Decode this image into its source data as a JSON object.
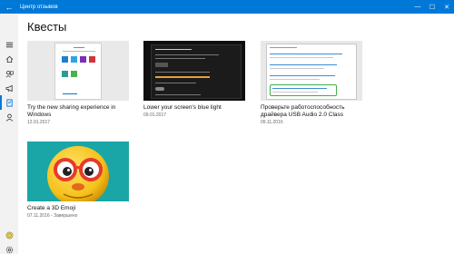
{
  "window": {
    "title": "Центр отзывов",
    "back_glyph": "←",
    "minimize_glyph": "—",
    "maximize_glyph": "☐",
    "close_glyph": "✕"
  },
  "sidebar": {
    "items": [
      {
        "icon": "hamburger-menu-icon"
      },
      {
        "icon": "home-icon"
      },
      {
        "icon": "feedback-icon"
      },
      {
        "icon": "announcements-icon"
      },
      {
        "icon": "quests-icon",
        "active": true
      },
      {
        "icon": "profile-icon"
      },
      {
        "icon": "achievement-icon"
      },
      {
        "icon": "settings-icon"
      }
    ]
  },
  "page": {
    "title": "Квесты"
  },
  "quests": [
    {
      "title": "Try the new sharing experience in Windows",
      "meta": "12.01.2017",
      "thumb": "sharing-screenshot"
    },
    {
      "title": "Lower your screen's blue light",
      "meta": "09.01.2017",
      "thumb": "night-light-settings-screenshot"
    },
    {
      "title": "Проверьте работоспособность драйвера USB Audio 2.0 Class",
      "meta": "09.11.2016",
      "thumb": "usb-audio-dialog-screenshot"
    },
    {
      "title": "Create a 3D Emoji",
      "meta": "07.11.2016 - Завершено",
      "thumb": "3d-emoji-image"
    }
  ],
  "colors": {
    "accent": "#0078d7",
    "highlight_green": "#3fae49",
    "emoji_bg": "#1aa6a6",
    "emoji_face": "#f6c21b"
  }
}
